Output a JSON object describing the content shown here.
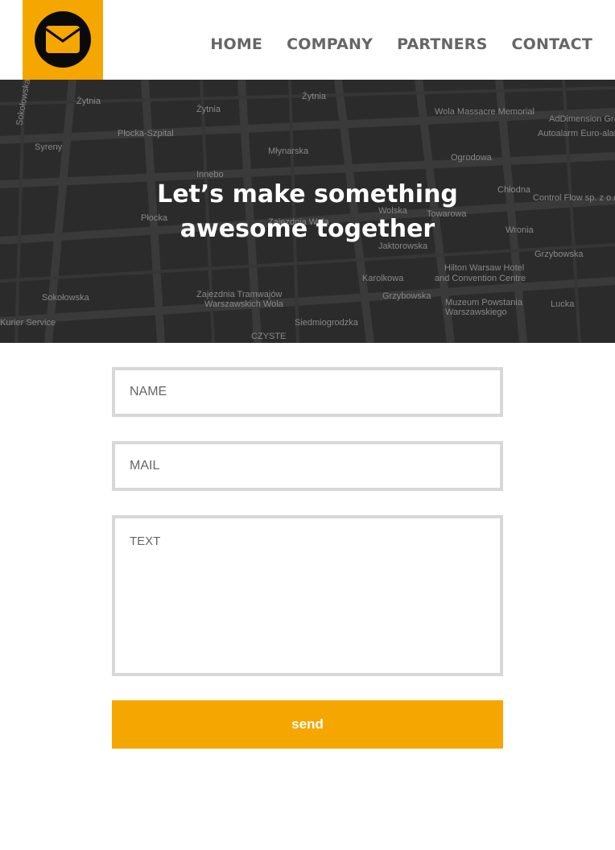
{
  "brand": {
    "logo_icon": "envelope-icon",
    "accent_color": "#f6a600"
  },
  "nav": {
    "items": [
      "HOME",
      "COMPANY",
      "PARTNERS",
      "CONTACT"
    ]
  },
  "hero": {
    "title_line1": "Let’s make something",
    "title_line2": "awesome together",
    "map_labels": [
      "Sokołowska",
      "Żytnia",
      "Płocka-Szpital",
      "Syreny",
      "Żytnia",
      "Młynarska",
      "Żytnia",
      "Wola Massacre Memorial",
      "AdDimension Group",
      "Autoalarm Euro-alarm",
      "Ogrodowa",
      "Chłodna",
      "Control Flow sp. z o.o.",
      "Innebo",
      "Zajezdnia Wola",
      "Wolska",
      "Jaktorowska",
      "Towarowa",
      "Wronia",
      "Grzybowska",
      "Hilton Warsaw Hotel",
      "and Convention Centre",
      "Sokołowska",
      "Zajezdnia Tramwajów",
      "Warszawskich Wola",
      "Siedmiogrodzka",
      "Karolkowa",
      "Grzybowska",
      "Muzeum Powstania",
      "Warszawskiego",
      "Lucka",
      "Kurier Service",
      "CZYSTE",
      "Płocka"
    ]
  },
  "form": {
    "name_placeholder": "NAME",
    "mail_placeholder": "MAIL",
    "text_placeholder": "TEXT",
    "send_label": "send"
  }
}
